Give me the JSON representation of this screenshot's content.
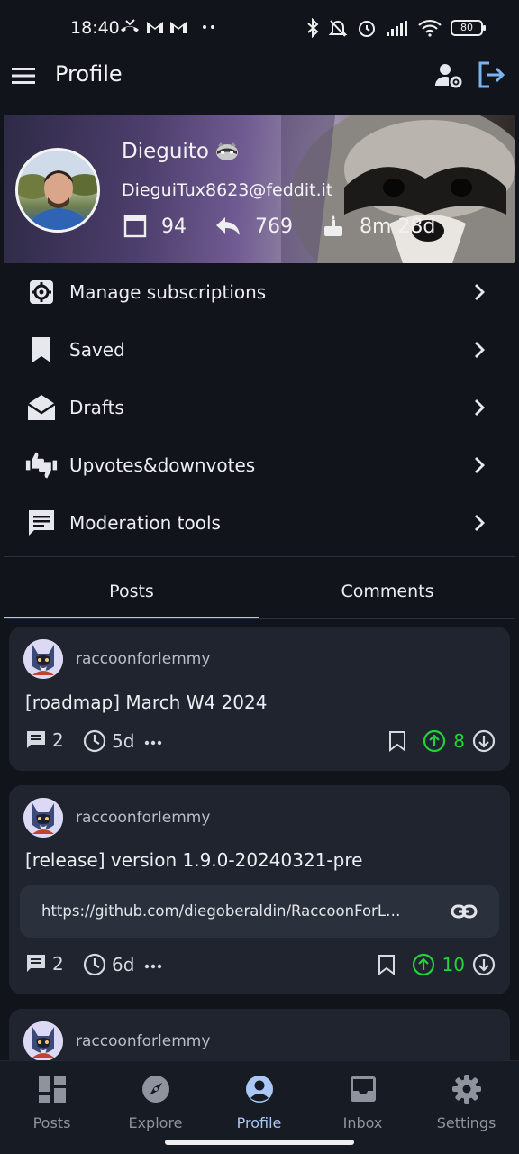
{
  "status_bar": {
    "time": "18:40",
    "battery": "80"
  },
  "top_bar": {
    "title": "Profile"
  },
  "profile": {
    "display_name": "Dieguito",
    "username": "DieguiTux8623@feddit.it",
    "posts_count": "94",
    "comments_count": "769",
    "account_age": "8m 28d"
  },
  "menu": {
    "items": [
      {
        "label": "Manage subscriptions",
        "icon": "gear-icon"
      },
      {
        "label": "Saved",
        "icon": "bookmark-icon"
      },
      {
        "label": "Drafts",
        "icon": "drafts-icon"
      },
      {
        "label": "Upvotes&downvotes",
        "icon": "thumbs-updown-icon"
      },
      {
        "label": "Moderation tools",
        "icon": "feedback-icon"
      }
    ]
  },
  "tabs": [
    {
      "label": "Posts",
      "active": true
    },
    {
      "label": "Comments",
      "active": false
    }
  ],
  "posts": [
    {
      "author": "raccoonforlemmy",
      "title": "[roadmap] March W4 2024",
      "comments": "2",
      "age": "5d",
      "score": "8"
    },
    {
      "author": "raccoonforlemmy",
      "title": "[release] version 1.9.0-20240321-pre",
      "url": "https://github.com/diegoberaldin/RaccoonForL…",
      "comments": "2",
      "age": "6d",
      "score": "10"
    },
    {
      "author": "raccoonforlemmy"
    }
  ],
  "bottom_nav": [
    {
      "label": "Posts",
      "icon": "dashboard-icon"
    },
    {
      "label": "Explore",
      "icon": "compass-icon"
    },
    {
      "label": "Profile",
      "icon": "account-circle-icon",
      "active": true
    },
    {
      "label": "Inbox",
      "icon": "inbox-icon"
    },
    {
      "label": "Settings",
      "icon": "gear-icon"
    }
  ],
  "colors": {
    "background": "#11141b",
    "card": "#1f242e",
    "accent": "#aac7f6",
    "upvote": "#21d43a"
  }
}
